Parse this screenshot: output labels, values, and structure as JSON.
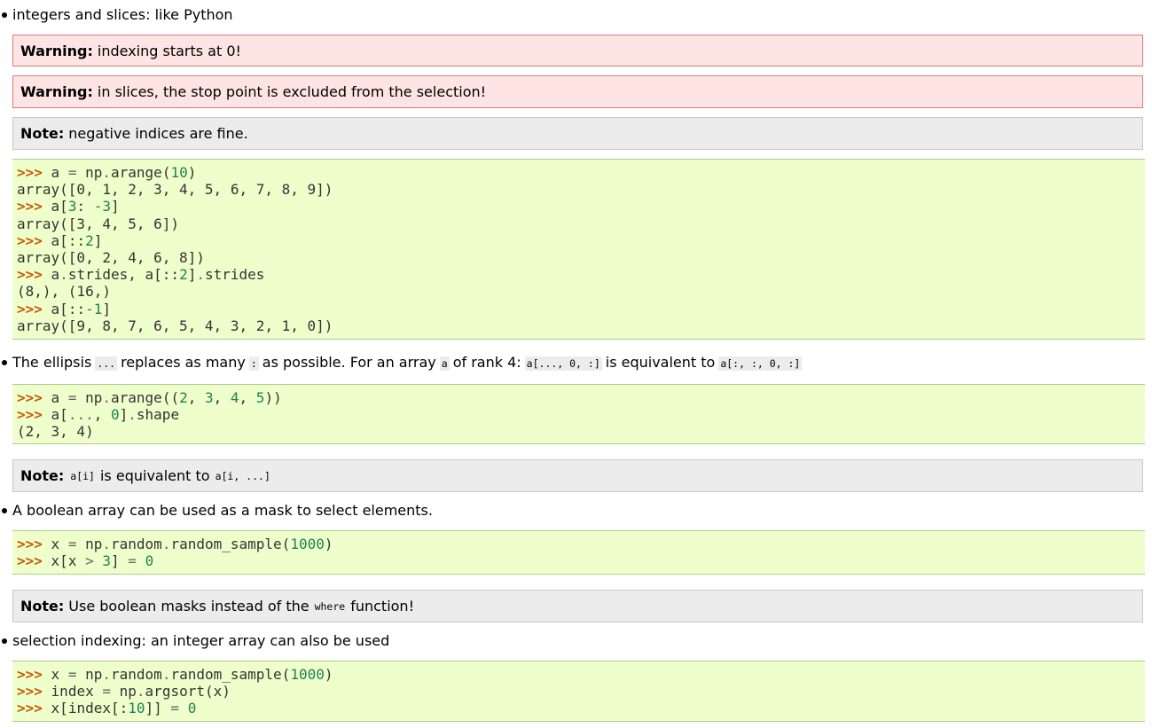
{
  "bullets": {
    "b1": "integers and slices: like Python",
    "b2": {
      "t1": "The ellipsis",
      "c1": "...",
      "t2": "replaces as many",
      "c2": ":",
      "t3": "as possible. For an array",
      "c3": "a",
      "t4": "of rank 4:",
      "c4": "a[..., 0, :]",
      "t5": "is equivalent to",
      "c5": "a[:, :, 0, :]"
    },
    "b3": "A boolean array can be used as a mask to select elements.",
    "b4": "selection indexing: an integer array can also be used"
  },
  "admonitions": {
    "warn1": {
      "label": "Warning:",
      "text": "indexing starts at 0!"
    },
    "warn2": {
      "label": "Warning:",
      "text": "in slices, the stop point is excluded from the selection!"
    },
    "note1": {
      "label": "Note:",
      "text": "negative indices are fine."
    },
    "note2": {
      "label": "Note:",
      "c1": "a[i]",
      "t1": "is equivalent to",
      "c2": "a[i, ...]"
    },
    "note3": {
      "label": "Note:",
      "t1": "Use boolean masks instead of the",
      "c1": "where",
      "t2": "function!"
    }
  },
  "code1": {
    "prompt": ">>>",
    "l1": {
      "a": "a",
      "eq": "=",
      "b": "np",
      "dot": ".",
      "c": "arange(",
      "n": "10",
      "d": ")"
    },
    "o1": "array([0, 1, 2, 3, 4, 5, 6, 7, 8, 9])",
    "l2": {
      "a": "a[",
      "n1": "3",
      "b": ":",
      "n2": "-3",
      "c": "]"
    },
    "o2": "array([3, 4, 5, 6])",
    "l3": {
      "a": "a[::",
      "n": "2",
      "b": "]"
    },
    "o3": "array([0, 2, 4, 6, 8])",
    "l4": {
      "a": "a",
      "dot1": ".",
      "b": "strides, a[::",
      "n": "2",
      "c": "]",
      "dot2": ".",
      "d": "strides"
    },
    "o4": "(8,), (16,)",
    "l5": {
      "a": "a[::",
      "n": "-1",
      "b": "]"
    },
    "o5": "array([9, 8, 7, 6, 5, 4, 3, 2, 1, 0])"
  },
  "code2": {
    "l1": {
      "a": "a",
      "eq": "=",
      "b": "np",
      "dot": ".",
      "c": "arange((",
      "n1": "2",
      "s1": ", ",
      "n2": "3",
      "s2": ", ",
      "n3": "4",
      "s3": ", ",
      "n4": "5",
      "d": "))"
    },
    "l2": {
      "a": "a[",
      "ell": "...",
      "s": ", ",
      "n": "0",
      "b": "]",
      "dot": ".",
      "c": "shape"
    },
    "o1": "(2, 3, 4)"
  },
  "code3": {
    "l1": {
      "a": "x",
      "eq": "=",
      "b": "np",
      "dot1": ".",
      "c": "random",
      "dot2": ".",
      "d": "random_sample(",
      "n": "1000",
      "e": ")"
    },
    "l2": {
      "a": "x[x",
      "gt": ">",
      "n1": "3",
      "b": "]",
      "eq": "=",
      "n2": "0"
    }
  },
  "code4": {
    "l1": {
      "a": "x",
      "eq": "=",
      "b": "np",
      "dot1": ".",
      "c": "random",
      "dot2": ".",
      "d": "random_sample(",
      "n": "1000",
      "e": ")"
    },
    "l2": {
      "a": "index",
      "eq": "=",
      "b": "np",
      "dot": ".",
      "c": "argsort(x)"
    },
    "l3": {
      "a": "x[index[:",
      "n1": "10",
      "b": "]]",
      "eq": "=",
      "n2": "0"
    }
  }
}
